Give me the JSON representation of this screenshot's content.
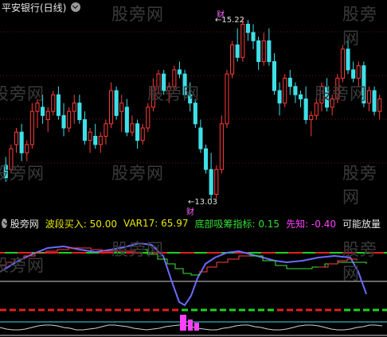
{
  "window": {
    "title": "平安银行(日线)",
    "watermark": "股旁网"
  },
  "main_chart": {
    "high_label": "15.22",
    "low_label": "13.03",
    "marker_top": "财",
    "marker_bottom": "财"
  },
  "indicator": {
    "name": "股旁网",
    "wave_buy": "波段买入: 50.00",
    "var17": "VAR17: 65.97",
    "bottom_absorb": "底部吸筹指标: 0.15",
    "foresee": "先知: -0.40",
    "possible": "可能放量"
  },
  "colors": {
    "up": "#ff3b3b",
    "down": "#3ee0e8",
    "label_gold": "#e8e800",
    "label_green": "#30e030",
    "label_magenta": "#ff40ff"
  },
  "chart_data": {
    "type": "candlestick",
    "title": "平安银行(日线)",
    "annotations": [
      {
        "text": "15.22",
        "value": 15.22
      },
      {
        "text": "13.03",
        "value": 13.03
      }
    ],
    "candles": [
      [
        13.45,
        13.55,
        13.25,
        13.3
      ],
      [
        13.4,
        13.7,
        13.35,
        13.65
      ],
      [
        13.7,
        13.9,
        13.6,
        13.85
      ],
      [
        13.85,
        13.95,
        13.5,
        13.6
      ],
      [
        13.6,
        13.75,
        13.5,
        13.7
      ],
      [
        13.7,
        14.2,
        13.65,
        14.1
      ],
      [
        14.1,
        14.25,
        13.9,
        14.2
      ],
      [
        14.15,
        14.3,
        13.95,
        14.05
      ],
      [
        14.0,
        14.15,
        13.85,
        14.1
      ],
      [
        14.1,
        14.35,
        14.05,
        14.3
      ],
      [
        14.3,
        14.4,
        14.0,
        14.05
      ],
      [
        14.05,
        14.2,
        13.8,
        13.9
      ],
      [
        13.9,
        14.15,
        13.85,
        14.1
      ],
      [
        14.1,
        14.3,
        13.95,
        14.2
      ],
      [
        14.2,
        14.3,
        13.95,
        14.0
      ],
      [
        14.0,
        14.1,
        13.7,
        13.75
      ],
      [
        13.75,
        13.9,
        13.6,
        13.85
      ],
      [
        13.8,
        13.95,
        13.65,
        13.7
      ],
      [
        13.7,
        13.85,
        13.6,
        13.8
      ],
      [
        13.8,
        14.0,
        13.7,
        13.95
      ],
      [
        13.95,
        14.45,
        13.9,
        14.35
      ],
      [
        14.35,
        14.4,
        14.0,
        14.05
      ],
      [
        14.1,
        14.3,
        13.85,
        14.2
      ],
      [
        14.15,
        14.25,
        13.8,
        13.85
      ],
      [
        13.85,
        14.05,
        13.8,
        13.95
      ],
      [
        13.95,
        14.0,
        13.65,
        13.75
      ],
      [
        13.75,
        13.95,
        13.7,
        13.9
      ],
      [
        13.9,
        14.2,
        13.85,
        14.15
      ],
      [
        14.15,
        14.5,
        14.1,
        14.4
      ],
      [
        14.4,
        14.6,
        14.3,
        14.55
      ],
      [
        14.55,
        14.6,
        14.3,
        14.35
      ],
      [
        14.35,
        14.45,
        14.2,
        14.4
      ],
      [
        14.4,
        14.65,
        14.35,
        14.6
      ],
      [
        14.6,
        14.7,
        14.5,
        14.55
      ],
      [
        14.55,
        14.6,
        14.25,
        14.3
      ],
      [
        14.3,
        14.45,
        14.1,
        14.2
      ],
      [
        14.2,
        14.25,
        13.9,
        13.95
      ],
      [
        13.9,
        14.0,
        13.6,
        13.65
      ],
      [
        13.65,
        13.7,
        13.35,
        13.4
      ],
      [
        13.4,
        13.6,
        13.03,
        13.1
      ],
      [
        13.1,
        13.45,
        13.05,
        13.4
      ],
      [
        13.4,
        14.05,
        13.35,
        13.95
      ],
      [
        13.95,
        14.6,
        13.9,
        14.55
      ],
      [
        14.55,
        14.95,
        14.5,
        14.9
      ],
      [
        14.9,
        15.1,
        14.7,
        14.75
      ],
      [
        14.75,
        15.22,
        14.7,
        15.15
      ],
      [
        15.15,
        15.2,
        14.95,
        15.05
      ],
      [
        15.05,
        15.15,
        14.85,
        14.95
      ],
      [
        14.95,
        15.0,
        14.6,
        14.7
      ],
      [
        14.7,
        15.05,
        14.65,
        14.95
      ],
      [
        14.95,
        15.1,
        14.65,
        14.7
      ],
      [
        14.7,
        14.8,
        14.3,
        14.35
      ],
      [
        14.35,
        14.45,
        14.05,
        14.2
      ],
      [
        14.2,
        14.55,
        14.15,
        14.5
      ],
      [
        14.5,
        14.6,
        14.3,
        14.4
      ],
      [
        14.4,
        14.45,
        14.2,
        14.3
      ],
      [
        14.3,
        14.35,
        14.15,
        14.25
      ],
      [
        14.25,
        14.4,
        13.95,
        14.0
      ],
      [
        14.0,
        14.1,
        13.8,
        14.05
      ],
      [
        14.05,
        14.25,
        14.0,
        14.2
      ],
      [
        14.2,
        14.45,
        14.1,
        14.4
      ],
      [
        14.4,
        14.5,
        14.1,
        14.15
      ],
      [
        14.15,
        14.3,
        14.05,
        14.25
      ],
      [
        14.25,
        14.55,
        14.2,
        14.5
      ],
      [
        14.5,
        14.9,
        14.45,
        14.85
      ],
      [
        14.85,
        15.0,
        14.55,
        14.6
      ],
      [
        14.6,
        14.7,
        14.45,
        14.5
      ],
      [
        14.5,
        14.7,
        14.4,
        14.65
      ],
      [
        14.65,
        14.7,
        14.15,
        14.2
      ],
      [
        14.2,
        14.4,
        14.1,
        14.35
      ],
      [
        14.35,
        14.4,
        14.05,
        14.1
      ],
      [
        14.1,
        14.3,
        14.0,
        14.25
      ]
    ]
  }
}
